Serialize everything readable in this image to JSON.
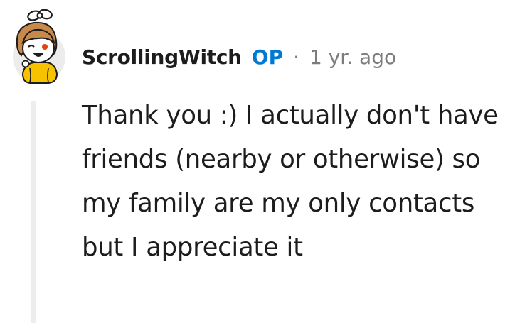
{
  "comment": {
    "author": "ScrollingWitch",
    "op_badge": "OP",
    "separator": "·",
    "timestamp": "1 yr. ago",
    "body": "Thank you :) I actually don't have friends (nearby or otherwise) so my family are my only contacts but I appreciate it"
  },
  "colors": {
    "op_accent": "#0079d3",
    "meta_gray": "#7c7c7c",
    "text": "#1c1c1c",
    "thread_line": "#ededed"
  }
}
